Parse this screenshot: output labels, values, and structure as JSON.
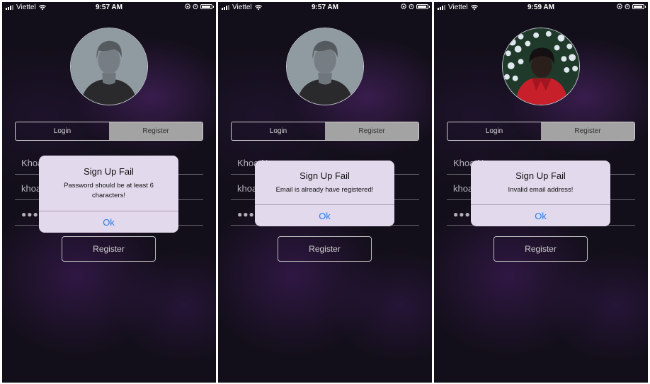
{
  "screens": [
    {
      "status": {
        "carrier": "Viettel",
        "time": "9:57 AM"
      },
      "avatar": "default-avatar",
      "tabs": {
        "login": "Login",
        "register": "Register",
        "selected": "register"
      },
      "fields": {
        "name": "Khoa",
        "email": "khoa",
        "password": "●●●●"
      },
      "register_button": "Register",
      "alert": {
        "title": "Sign Up Fail",
        "message": "Password should be at least 6 characters!",
        "button": "Ok"
      }
    },
    {
      "status": {
        "carrier": "Viettel",
        "time": "9:57 AM"
      },
      "avatar": "default-avatar",
      "tabs": {
        "login": "Login",
        "register": "Register",
        "selected": "register"
      },
      "fields": {
        "name": "Khoa Nguyen",
        "email": "khoa",
        "password": "●●●●"
      },
      "register_button": "Register",
      "alert": {
        "title": "Sign Up Fail",
        "message": "Email is already have registered!",
        "button": "Ok"
      }
    },
    {
      "status": {
        "carrier": "Viettel",
        "time": "9:59 AM"
      },
      "avatar": "photo-avatar",
      "tabs": {
        "login": "Login",
        "register": "Register",
        "selected": "register"
      },
      "fields": {
        "name": "Khoa Nguyen",
        "email": "khoa",
        "password": "●●●●"
      },
      "register_button": "Register",
      "alert": {
        "title": "Sign Up Fail",
        "message": "Invalid email address!",
        "button": "Ok"
      }
    }
  ],
  "colors": {
    "alert_button": "#2a7ae2",
    "segment_selected": "#a3a3a3",
    "alert_bg": "#e3d9ec"
  }
}
